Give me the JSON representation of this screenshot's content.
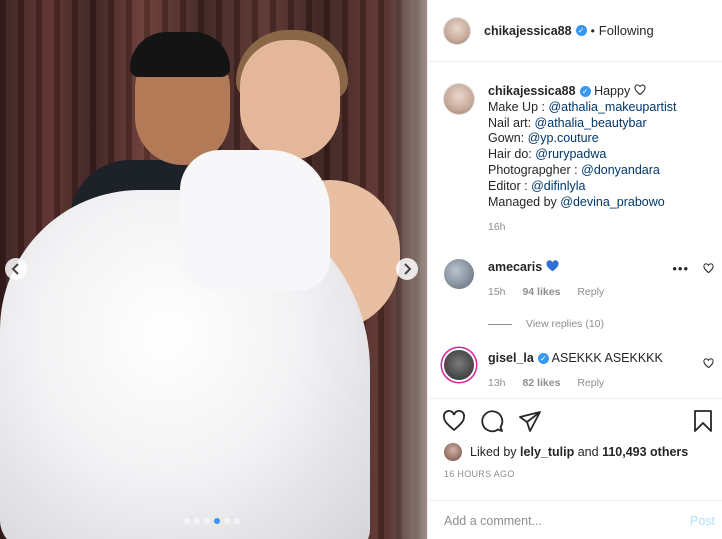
{
  "post": {
    "username": "chikajessica88",
    "follow_status": "Following",
    "separator": "•",
    "carousel": {
      "slides": 6,
      "active_index": 3,
      "prev_icon": "chevron-left-icon",
      "next_icon": "chevron-right-icon"
    }
  },
  "caption": {
    "username": "chikajessica88",
    "text": "Happy",
    "lines": [
      {
        "label": "Make Up : ",
        "mention": "@athalia_makeupartist"
      },
      {
        "label": "Nail art: ",
        "mention": "@athalia_beautybar"
      },
      {
        "label": "Gown: ",
        "mention": "@yp.couture"
      },
      {
        "label": "Hair do: ",
        "mention": "@rurypadwa"
      },
      {
        "label": "Photograpgher : ",
        "mention": "@donyandara"
      },
      {
        "label": "Editor : ",
        "mention": "@difinlyla"
      },
      {
        "label": "Managed by ",
        "mention": "@devina_prabowo"
      }
    ],
    "age": "16h"
  },
  "comments": [
    {
      "username": "amecaris",
      "text": "",
      "age": "15h",
      "likes": "94 likes",
      "reply": "Reply"
    },
    {
      "username": "gisel_la",
      "text": "ASEKKK ASEKKKK",
      "age": "13h",
      "likes": "82 likes",
      "reply": "Reply"
    }
  ],
  "view_replies": "View replies (10)",
  "likes": {
    "prefix": "Liked by",
    "user": "lely_tulip",
    "connector": "and",
    "others": "110,493 others"
  },
  "timestamp": "16 HOURS AGO",
  "comment_box": {
    "placeholder": "Add a comment...",
    "post_label": "Post"
  },
  "colors": {
    "verified": "#3897f0",
    "mention": "#00376b",
    "muted": "#8e8e8e",
    "post_disabled": "#b2dffc"
  }
}
